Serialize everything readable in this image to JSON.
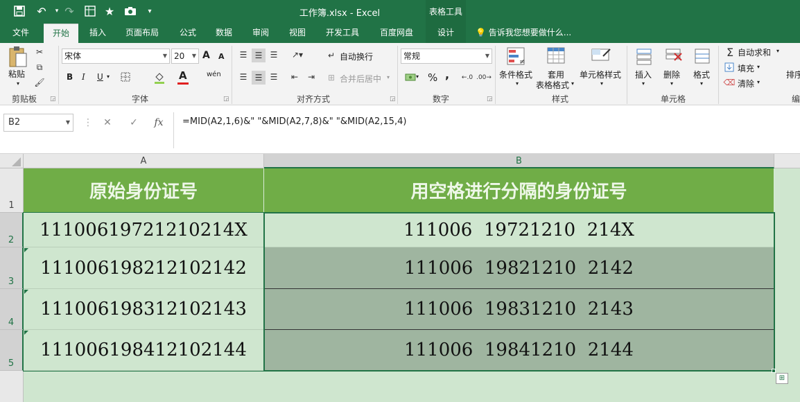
{
  "window": {
    "title": "工作簿.xlsx - Excel",
    "context_group": "表格工具"
  },
  "tabs": [
    {
      "label": "文件"
    },
    {
      "label": "开始"
    },
    {
      "label": "插入"
    },
    {
      "label": "页面布局"
    },
    {
      "label": "公式"
    },
    {
      "label": "数据"
    },
    {
      "label": "审阅"
    },
    {
      "label": "视图"
    },
    {
      "label": "开发工具"
    },
    {
      "label": "百度网盘"
    },
    {
      "label": "设计"
    }
  ],
  "tell_me": "告诉我您想要做什么...",
  "ribbon": {
    "clipboard": {
      "group": "剪贴板",
      "paste": "粘贴"
    },
    "font": {
      "group": "字体",
      "name": "宋体",
      "size": "20",
      "bold": "B",
      "italic": "I",
      "underline": "U",
      "grow": "A",
      "shrink": "A",
      "color": "A",
      "wen": "wén"
    },
    "alignment": {
      "group": "对齐方式",
      "wrap": "自动换行",
      "merge": "合并后居中"
    },
    "number": {
      "group": "数字",
      "format": "常规",
      "percent": "%",
      "comma": ","
    },
    "styles": {
      "group": "样式",
      "conditional": "条件格式",
      "table_fmt_1": "套用",
      "table_fmt_2": "表格格式",
      "cell_styles": "单元格样式"
    },
    "cells": {
      "group": "单元格",
      "insert": "插入",
      "delete": "删除",
      "format": "格式"
    },
    "editing": {
      "group": "编",
      "autosum": "自动求和",
      "fill": "填充",
      "clear": "清除",
      "sort": "排序"
    }
  },
  "formula_bar": {
    "name_box": "B2",
    "fx": "fx",
    "formula": "=MID(A2,1,6)&\" \"&MID(A2,7,8)&\" \"&MID(A2,15,4)"
  },
  "columns": [
    "A",
    "B"
  ],
  "rows": [
    "1",
    "2",
    "3",
    "4",
    "5"
  ],
  "sheet": {
    "header": [
      "原始身份证号",
      "用空格进行分隔的身份证号"
    ],
    "data": [
      [
        "11100619721210214X",
        "111006  19721210  214X"
      ],
      [
        "111006198212102142",
        "111006  19821210  2142"
      ],
      [
        "111006198312102143",
        "111006  19831210  2143"
      ],
      [
        "111006198412102144",
        "111006  19841210  2144"
      ]
    ]
  },
  "colors": {
    "brand": "#217346",
    "header_fill": "#70ad47",
    "cell_fill": "#cfe6cf",
    "selection_fill": "#9fb5a0"
  }
}
